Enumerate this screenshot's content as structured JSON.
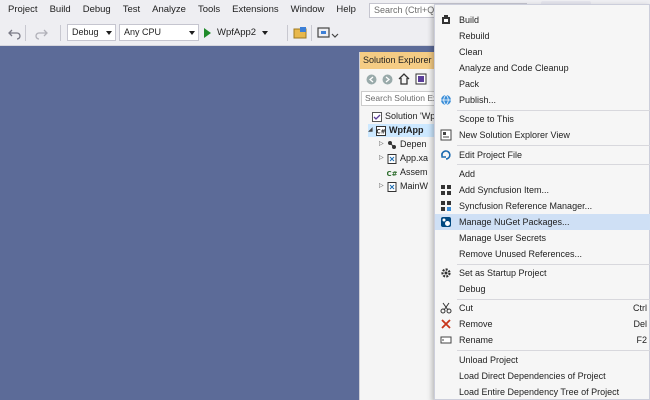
{
  "menubar": {
    "items": [
      "Project",
      "Build",
      "Debug",
      "Test",
      "Analyze",
      "Tools",
      "Extensions",
      "Window",
      "Help"
    ],
    "search_placeholder": "Search (Ctrl+Q)"
  },
  "toolbar": {
    "config": "Debug",
    "platform": "Any CPU",
    "run_target": "WpfApp2"
  },
  "solution_explorer": {
    "title": "Solution Explorer",
    "search_placeholder": "Search Solution Ex",
    "tree": [
      {
        "label": "Solution 'Wp"
      },
      {
        "label": "WpfApp"
      },
      {
        "label": "Depen"
      },
      {
        "label": "App.xa"
      },
      {
        "label": "Assem"
      },
      {
        "label": "MainW"
      }
    ]
  },
  "context_menu": {
    "items": [
      {
        "label": "Build",
        "icon": "build-icon"
      },
      {
        "label": "Rebuild",
        "icon": ""
      },
      {
        "label": "Clean",
        "icon": ""
      },
      {
        "label": "Analyze and Code Cleanup",
        "icon": ""
      },
      {
        "label": "Pack",
        "icon": ""
      },
      {
        "label": "Publish...",
        "icon": "publish-icon"
      },
      {
        "label": "Scope to This",
        "icon": ""
      },
      {
        "label": "New Solution Explorer View",
        "icon": "new-view-icon"
      },
      {
        "label": "Edit Project File",
        "icon": "edit-icon"
      },
      {
        "label": "Add",
        "icon": ""
      },
      {
        "label": "Add Syncfusion Item...",
        "icon": "syncfusion-icon"
      },
      {
        "label": "Syncfusion Reference Manager...",
        "icon": "syncfusion-ref-icon"
      },
      {
        "label": "Manage NuGet Packages...",
        "icon": "nuget-icon"
      },
      {
        "label": "Manage User Secrets",
        "icon": ""
      },
      {
        "label": "Remove Unused References...",
        "icon": ""
      },
      {
        "label": "Set as Startup Project",
        "icon": "gear-icon"
      },
      {
        "label": "Debug",
        "icon": ""
      },
      {
        "label": "Cut",
        "icon": "cut-icon",
        "shortcut": "Ctrl"
      },
      {
        "label": "Remove",
        "icon": "remove-icon",
        "shortcut": "Del"
      },
      {
        "label": "Rename",
        "icon": "rename-icon",
        "shortcut": "F2"
      },
      {
        "label": "Unload Project",
        "icon": ""
      },
      {
        "label": "Load Direct Dependencies of Project",
        "icon": ""
      },
      {
        "label": "Load Entire Dependency Tree of Project",
        "icon": ""
      }
    ],
    "highlighted_item": "Manage NuGet Packages..."
  },
  "colors": {
    "background": "#5c6b98",
    "chrome": "#eeeef2",
    "solution_explorer_title": "#f5cc84",
    "highlight": "#cfe0f5"
  }
}
